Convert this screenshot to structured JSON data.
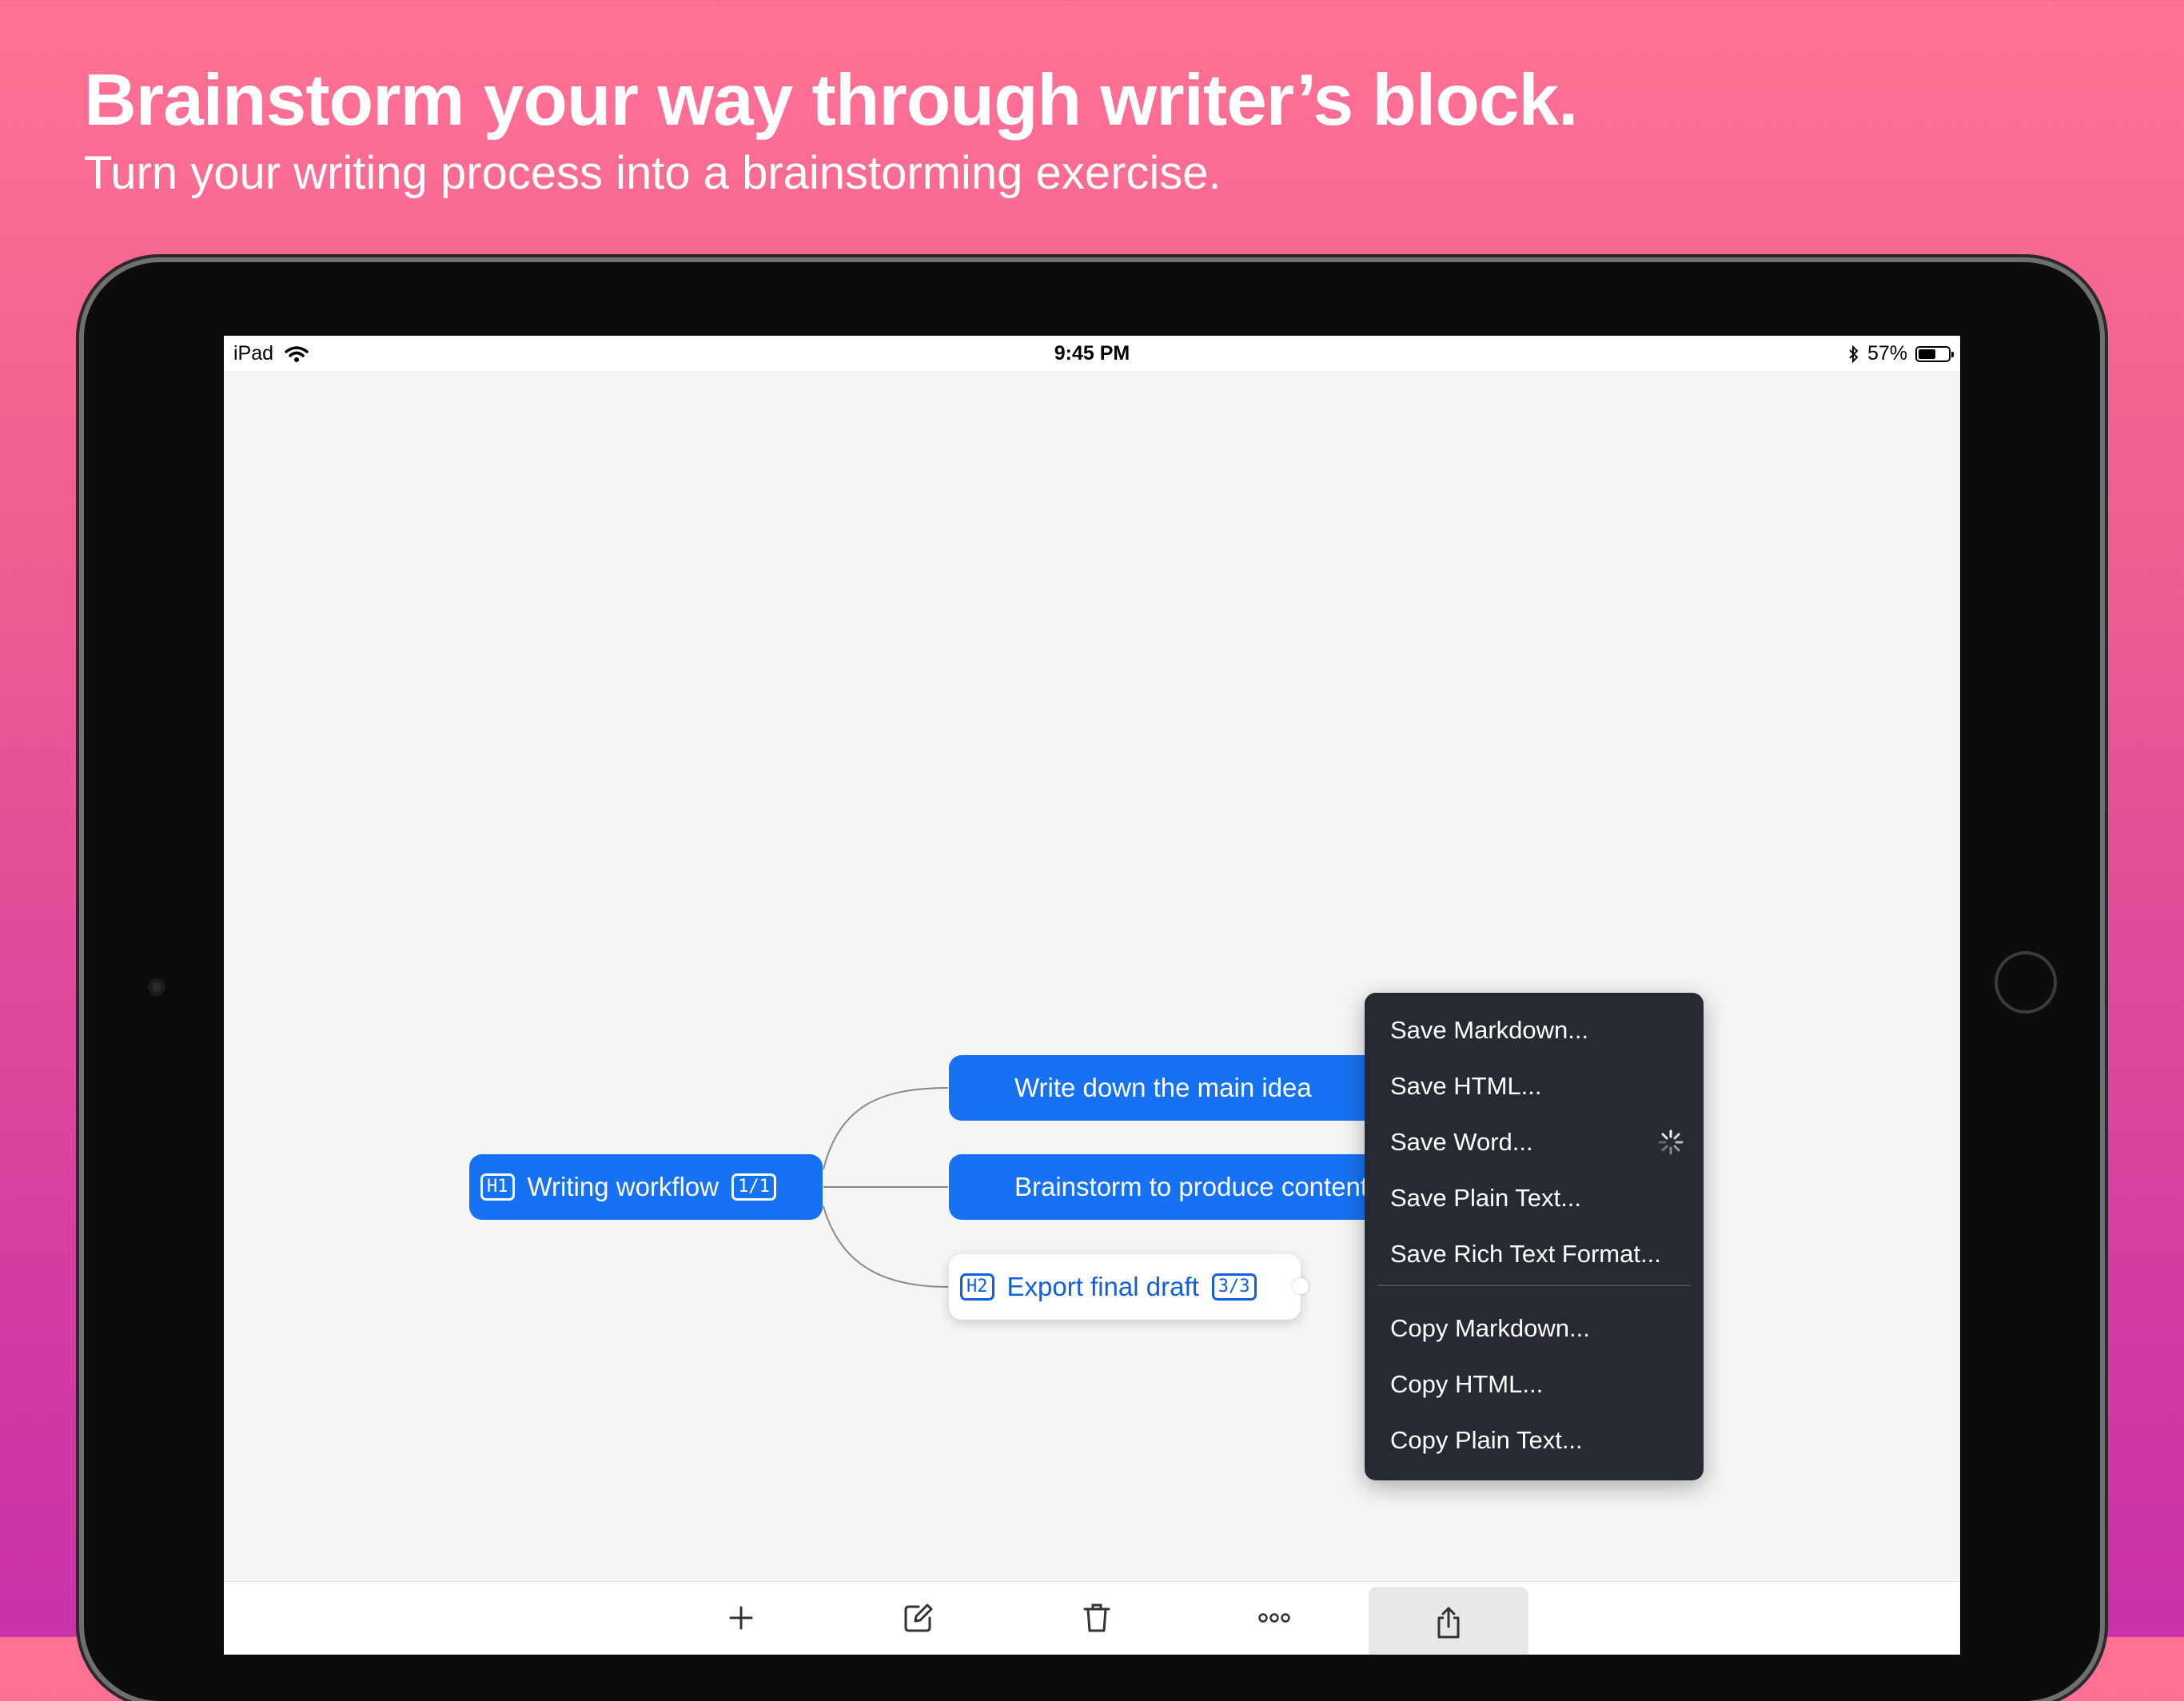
{
  "hero": {
    "title": "Brainstorm your way through writer’s block.",
    "subtitle": "Turn your writing process into a brainstorming exercise."
  },
  "status_bar": {
    "device": "iPad",
    "time": "9:45 PM",
    "battery": "57%",
    "battery_level": 0.57
  },
  "mind_map": {
    "root": {
      "tag": "H1",
      "label": "Writing workflow",
      "count": "1/1"
    },
    "children": [
      {
        "label": "Write down the main idea"
      },
      {
        "label": "Brainstorm to produce content"
      },
      {
        "tag": "H2",
        "label": "Export final draft",
        "count": "3/3"
      }
    ]
  },
  "export_menu": {
    "save_items": [
      "Save Markdown...",
      "Save HTML...",
      "Save Word...",
      "Save Plain Text...",
      "Save Rich Text Format..."
    ],
    "copy_items": [
      "Copy Markdown...",
      "Copy HTML...",
      "Copy Plain Text..."
    ]
  },
  "toolbar": {
    "icons": [
      "plus-icon",
      "edit-icon",
      "trash-icon",
      "more-icon",
      "share-icon"
    ]
  },
  "colors": {
    "accent": "#1672f2",
    "menu_background": "#262a33",
    "background_gradient_top": "#ff7294",
    "background_gradient_bottom": "#c932a8"
  }
}
